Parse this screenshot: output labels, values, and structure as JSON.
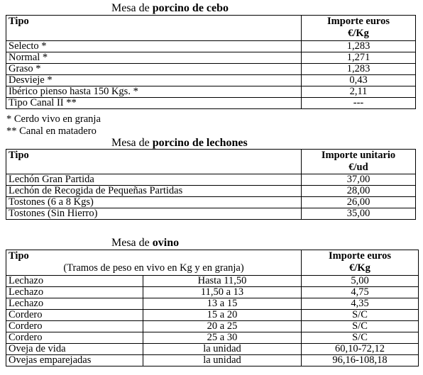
{
  "sections": {
    "cebo": {
      "title_prefix": "Mesa de ",
      "title_bold": "porcino de cebo",
      "header": {
        "tipo": "Tipo",
        "importe_line1": "Importe euros",
        "importe_line2": "€/Kg"
      },
      "rows": [
        {
          "tipo": "Selecto *",
          "importe": "1,283"
        },
        {
          "tipo": "Normal *",
          "importe": "1,271"
        },
        {
          "tipo": "Graso *",
          "importe": "1,283"
        },
        {
          "tipo": "Desvieje *",
          "importe": "0,43"
        },
        {
          "tipo": "Ibérico pienso hasta 150 Kgs. *",
          "importe": "2,11"
        },
        {
          "tipo": "Tipo Canal II **",
          "importe": "---"
        }
      ],
      "notes": [
        "* Cerdo vivo en granja",
        "** Canal en matadero"
      ]
    },
    "lechones": {
      "title_prefix": "Mesa de ",
      "title_bold": "porcino de lechones",
      "header": {
        "tipo": "Tipo",
        "importe_line1": "Importe unitario",
        "importe_line2": "€/ud"
      },
      "rows": [
        {
          "tipo": "Lechón Gran Partida",
          "importe": "37,00"
        },
        {
          "tipo": "Lechón de Recogida de Pequeñas Partidas",
          "importe": "28,00"
        },
        {
          "tipo": "Tostones (6 a 8 Kgs)",
          "importe": "26,00"
        },
        {
          "tipo": "Tostones  (Sin Hierro)",
          "importe": "35,00"
        }
      ]
    },
    "ovino": {
      "title_prefix": "Mesa de ",
      "title_bold": "ovino",
      "header": {
        "tipo": "Tipo",
        "tipo_sub": "(Tramos de peso en vivo en Kg y en granja)",
        "importe_line1": "Importe euros",
        "importe_line2": "€/Kg"
      },
      "rows": [
        {
          "tipo": "Lechazo",
          "tramo": "Hasta 11,50",
          "importe": "5,00"
        },
        {
          "tipo": "Lechazo",
          "tramo": "11,50 a 13",
          "importe": "4,75"
        },
        {
          "tipo": "Lechazo",
          "tramo": "13 a 15",
          "importe": "4,35"
        },
        {
          "tipo": "Cordero",
          "tramo": "15 a 20",
          "importe": "S/C"
        },
        {
          "tipo": "Cordero",
          "tramo": "20 a 25",
          "importe": "S/C"
        },
        {
          "tipo": "Cordero",
          "tramo": "25 a 30",
          "importe": "S/C"
        },
        {
          "tipo": "Oveja de vida",
          "tramo": "la unidad",
          "importe": "60,10-72,12"
        },
        {
          "tipo": "Ovejas emparejadas",
          "tramo": "la unidad",
          "importe": "96,16-108,18"
        }
      ]
    }
  }
}
